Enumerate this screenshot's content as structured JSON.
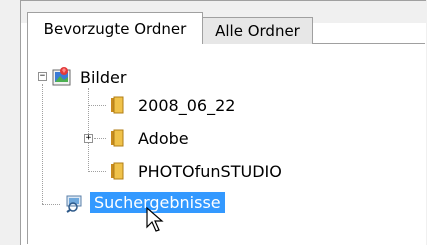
{
  "tabs": [
    {
      "label": "Bevorzugte Ordner",
      "active": true
    },
    {
      "label": "Alle Ordner",
      "active": false
    }
  ],
  "tree": {
    "root": {
      "label": "Bilder",
      "icon": "pictures-folder-icon",
      "expanded": true
    },
    "children": [
      {
        "label": "2008_06_22",
        "icon": "folder-icon",
        "expandable": false
      },
      {
        "label": "Adobe",
        "icon": "folder-icon",
        "expandable": true
      },
      {
        "label": "PHOTOfunSTUDIO",
        "icon": "folder-icon",
        "expandable": false
      }
    ],
    "search": {
      "label": "Suchergebnisse",
      "icon": "search-results-icon",
      "selected": true
    }
  },
  "colors": {
    "selection": "#3399ff",
    "folder": "#e8b536"
  }
}
